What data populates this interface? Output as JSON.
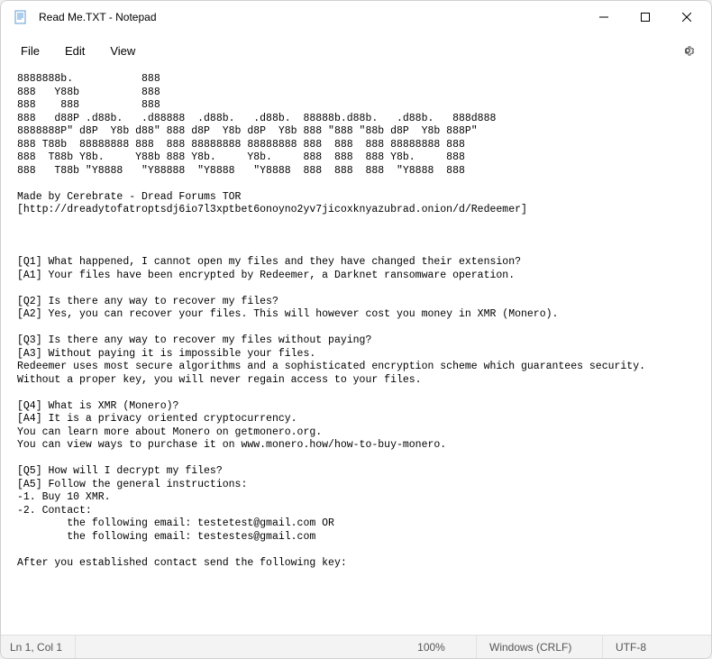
{
  "titlebar": {
    "icon": "notepad-icon",
    "title": "Read Me.TXT - Notepad"
  },
  "menubar": {
    "file": "File",
    "edit": "Edit",
    "view": "View"
  },
  "content": {
    "text": "8888888b.           888\n888   Y88b          888\n888    888          888\n888   d88P .d88b.   .d88888  .d88b.   .d88b.  88888b.d88b.   .d88b.   888d888\n8888888P\" d8P  Y8b d88\" 888 d8P  Y8b d8P  Y8b 888 \"888 \"88b d8P  Y8b 888P\"\n888 T88b  88888888 888  888 88888888 88888888 888  888  888 88888888 888\n888  T88b Y8b.     Y88b 888 Y8b.     Y8b.     888  888  888 Y8b.     888\n888   T88b \"Y8888   \"Y88888  \"Y8888   \"Y8888  888  888  888  \"Y8888  888\n\nMade by Cerebrate - Dread Forums TOR\n[http://dreadytofatroptsdj6io7l3xptbet6onoyno2yv7jicoxknyazubrad.onion/d/Redeemer]\n\n\n\n[Q1] What happened, I cannot open my files and they have changed their extension?\n[A1] Your files have been encrypted by Redeemer, a Darknet ransomware operation.\n\n[Q2] Is there any way to recover my files?\n[A2] Yes, you can recover your files. This will however cost you money in XMR (Monero).\n\n[Q3] Is there any way to recover my files without paying?\n[A3] Without paying it is impossible your files.\nRedeemer uses most secure algorithms and a sophisticated encryption scheme which guarantees security.\nWithout a proper key, you will never regain access to your files.\n\n[Q4] What is XMR (Monero)?\n[A4] It is a privacy oriented cryptocurrency.\nYou can learn more about Monero on getmonero.org.\nYou can view ways to purchase it on www.monero.how/how-to-buy-monero.\n\n[Q5] How will I decrypt my files?\n[A5] Follow the general instructions:\n-1. Buy 10 XMR.\n-2. Contact:\n        the following email: testetest@gmail.com OR\n        the following email: testestes@gmail.com\n\nAfter you established contact send the following key:"
  },
  "statusbar": {
    "position": "Ln 1, Col 1",
    "zoom": "100%",
    "line_ending": "Windows (CRLF)",
    "encoding": "UTF-8"
  }
}
